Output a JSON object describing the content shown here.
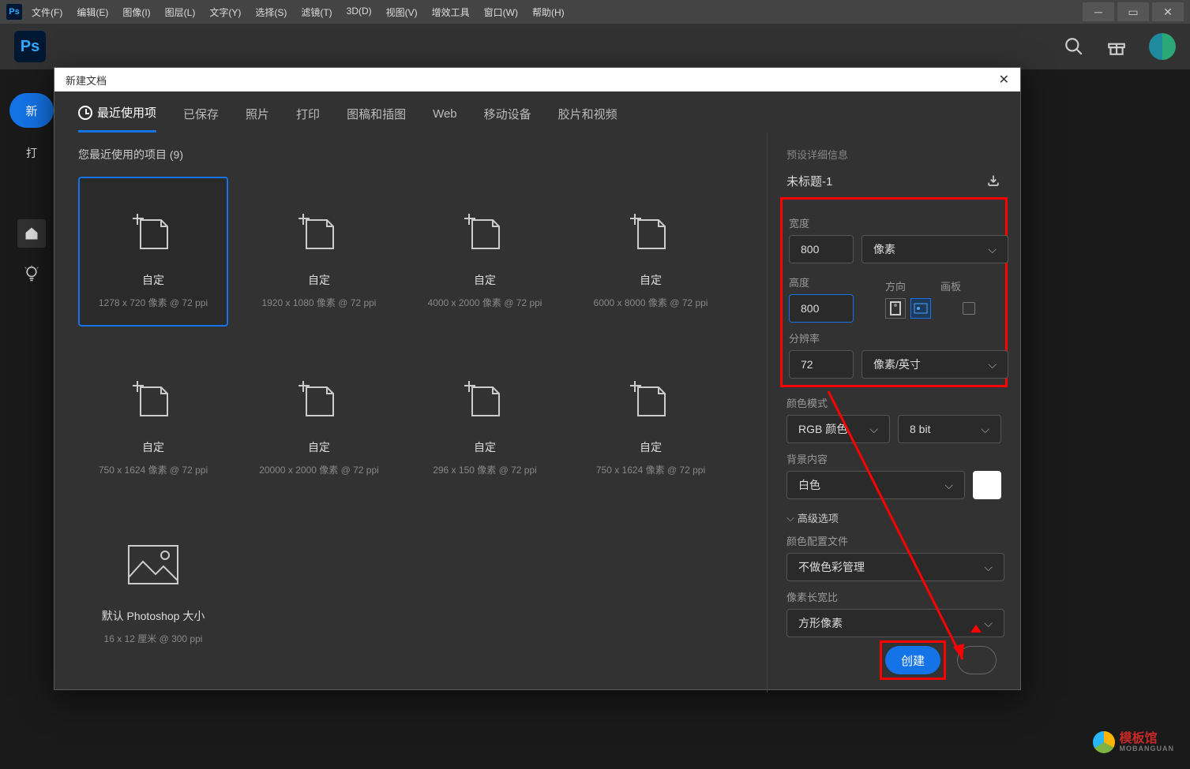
{
  "menu": [
    "文件(F)",
    "编辑(E)",
    "图像(I)",
    "图层(L)",
    "文字(Y)",
    "选择(S)",
    "滤镜(T)",
    "3D(D)",
    "视图(V)",
    "增效工具",
    "窗口(W)",
    "帮助(H)"
  ],
  "home": {
    "new": "新",
    "open": "打"
  },
  "dialog": {
    "title": "新建文档",
    "tabs": [
      "最近使用项",
      "已保存",
      "照片",
      "打印",
      "图稿和插图",
      "Web",
      "移动设备",
      "胶片和视频"
    ],
    "recent_label": "您最近使用的项目 (9)",
    "cards": [
      {
        "t": "自定",
        "s": "1278 x 720 像素 @ 72 ppi"
      },
      {
        "t": "自定",
        "s": "1920 x 1080 像素 @ 72 ppi"
      },
      {
        "t": "自定",
        "s": "4000 x 2000 像素 @ 72 ppi"
      },
      {
        "t": "自定",
        "s": "6000 x 8000 像素 @ 72 ppi"
      },
      {
        "t": "自定",
        "s": "750 x 1624 像素 @ 72 ppi"
      },
      {
        "t": "自定",
        "s": "20000 x 2000 像素 @ 72 ppi"
      },
      {
        "t": "自定",
        "s": "296 x 150 像素 @ 72 ppi"
      },
      {
        "t": "自定",
        "s": "750 x 1624 像素 @ 72 ppi"
      },
      {
        "t": "默认 Photoshop 大小",
        "s": "16 x 12 厘米 @ 300 ppi"
      }
    ],
    "preset_label": "预设详细信息",
    "doc_name": "未标题-1",
    "width_label": "宽度",
    "width": "800",
    "width_unit": "像素",
    "height_label": "高度",
    "height": "800",
    "orient_label": "方向",
    "artboard_label": "画板",
    "res_label": "分辨率",
    "res": "72",
    "res_unit": "像素/英寸",
    "mode_label": "颜色模式",
    "mode": "RGB 颜色",
    "depth": "8 bit",
    "bg_label": "背景内容",
    "bg": "白色",
    "adv": "高级选项",
    "profile_label": "颜色配置文件",
    "profile": "不做色彩管理",
    "aspect_label": "像素长宽比",
    "aspect": "方形像素",
    "create": "创建"
  },
  "watermark": {
    "name": "模板馆",
    "sub": "MOBANGUAN"
  }
}
